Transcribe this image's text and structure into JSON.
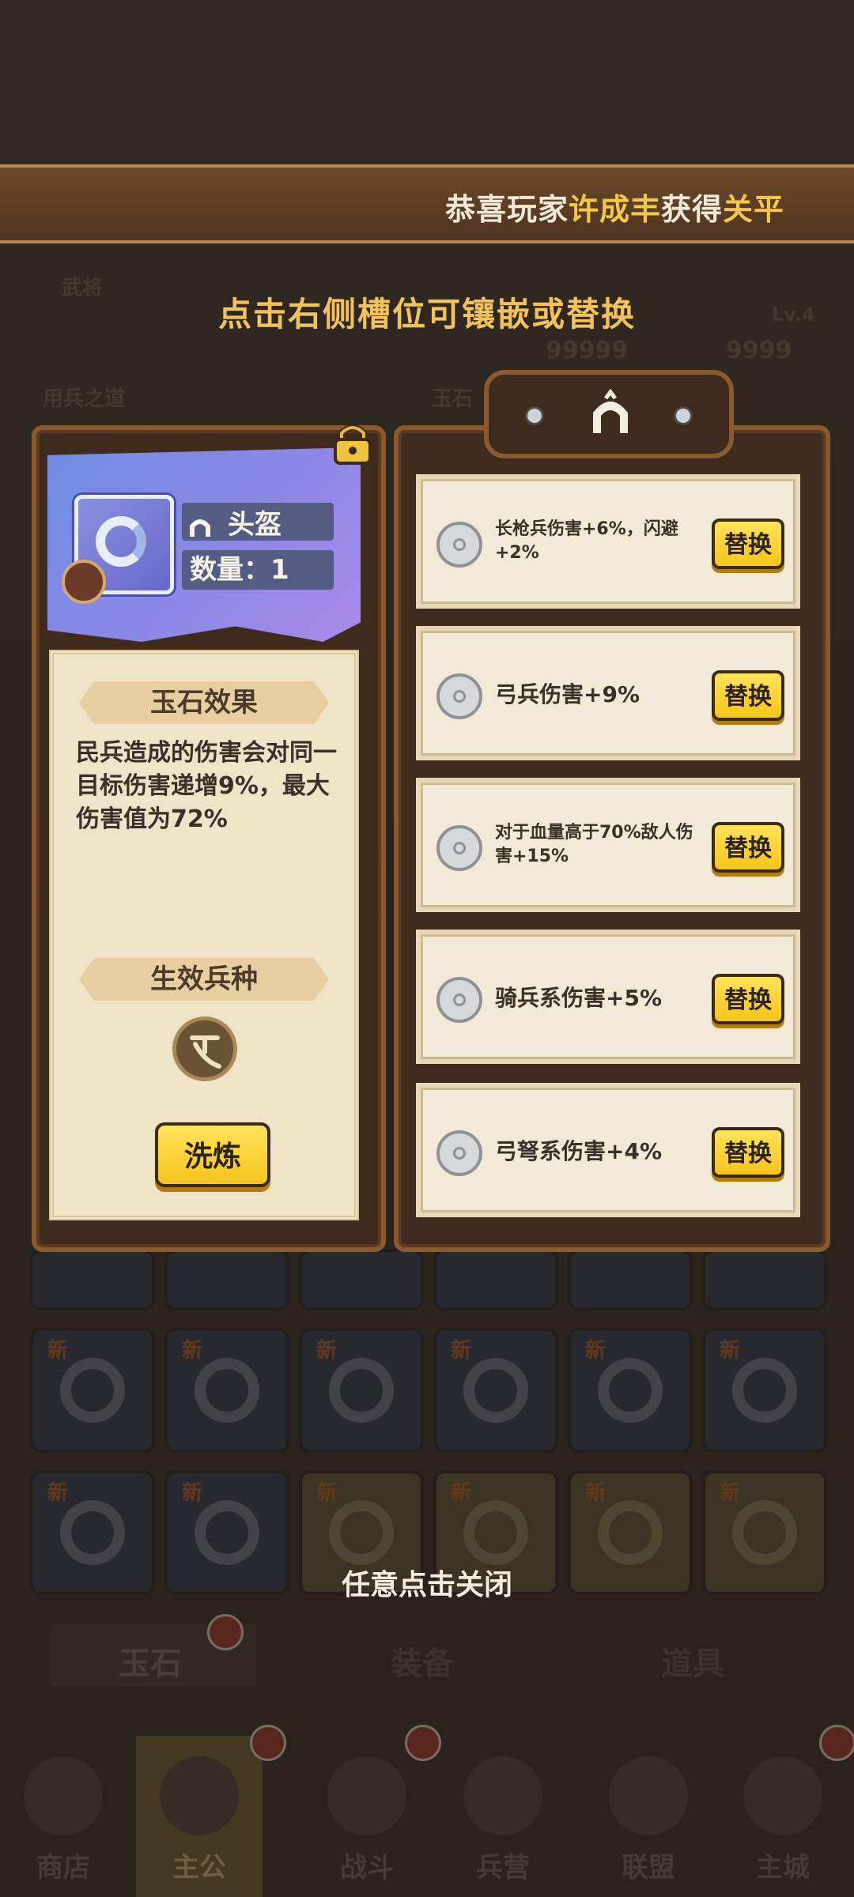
{
  "banner": {
    "pre": "恭喜玩家",
    "player": "许成丰",
    "mid": "获得",
    "item": "关平"
  },
  "hint": "点击右侧槽位可镶嵌或替换",
  "item": {
    "name": "头盔",
    "count_label": "数量：",
    "count": "1",
    "effect_title": "玉石效果",
    "effect_text": "民兵造成的伤害会对同一目标伤害递增9%，最大伤害值为72%",
    "troop_title": "生效兵种",
    "refine_label": "洗炼"
  },
  "slots": [
    {
      "text": "长枪兵伤害+6%，闪避+2%",
      "button": "替换"
    },
    {
      "text": "弓兵伤害+9%",
      "button": "替换"
    },
    {
      "text": "对于血量高于70%敌人伤害+15%",
      "button": "替换"
    },
    {
      "text": "骑兵系伤害+5%",
      "button": "替换"
    },
    {
      "text": "弓弩系伤害+4%",
      "button": "替换"
    }
  ],
  "close_hint": "任意点击关闭",
  "background": {
    "side_labels": [
      "武将",
      "用兵之道"
    ],
    "top_values": [
      "99999",
      "9999"
    ],
    "level": "Lv.4",
    "jade_label": "玉石",
    "new_tag": "新",
    "tabs": [
      "玉石",
      "装备",
      "道具"
    ]
  },
  "nav": [
    "商店",
    "主公",
    "战斗",
    "兵营",
    "联盟",
    "主城"
  ],
  "colors": {
    "highlight": "#f2c84a",
    "button": "#f6c41c",
    "panel_border": "#8a5a2e"
  }
}
